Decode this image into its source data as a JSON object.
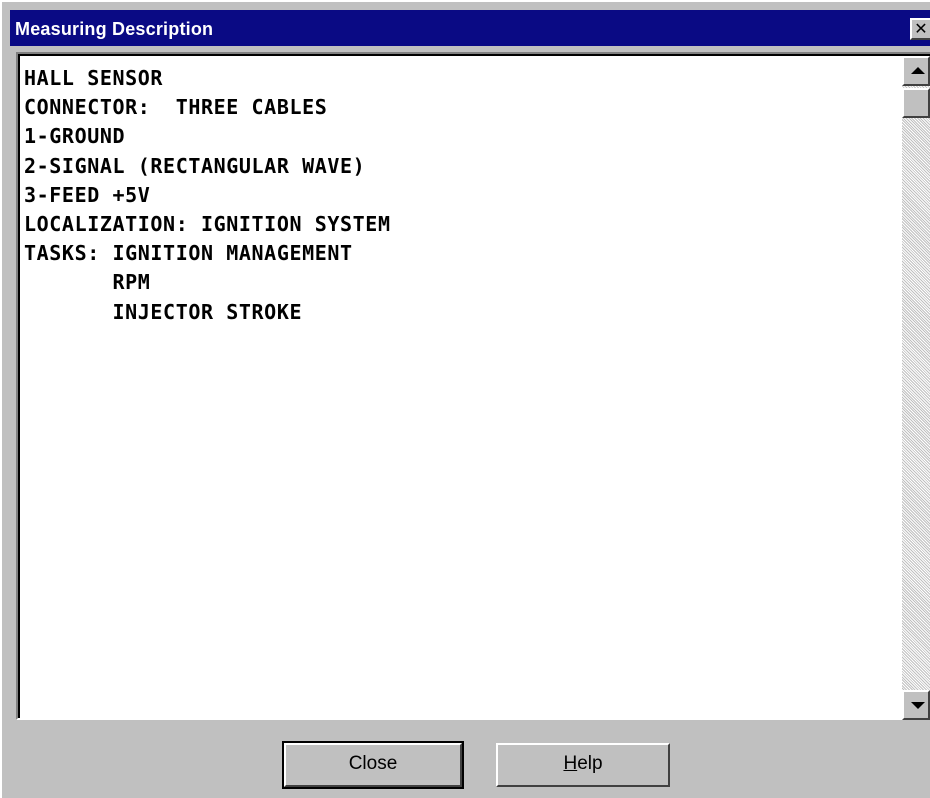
{
  "window": {
    "title": "Measuring Description",
    "close_glyph": "✕",
    "title_bar_color": "#0a0a84",
    "face_color": "#c0c0c0"
  },
  "description": {
    "lines": [
      "HALL SENSOR",
      "CONNECTOR:  THREE CABLES",
      "1-GROUND",
      "2-SIGNAL (RECTANGULAR WAVE)",
      "3-FEED +5V",
      "LOCALIZATION: IGNITION SYSTEM",
      "TASKS: IGNITION MANAGEMENT",
      "       RPM",
      "       INJECTOR STROKE"
    ]
  },
  "scrollbar": {
    "up_icon": "triangle-up-icon",
    "down_icon": "triangle-down-icon"
  },
  "buttons": {
    "close_label": "Close",
    "help_accel": "H",
    "help_rest": "elp"
  }
}
